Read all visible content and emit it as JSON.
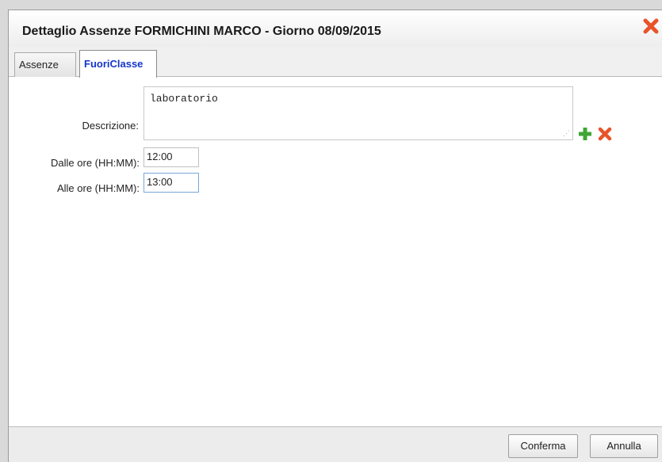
{
  "dialog": {
    "title": "Dettaglio Assenze FORMICHINI MARCO - Giorno 08/09/2015"
  },
  "tabs": [
    {
      "label": "Assenze",
      "active": false
    },
    {
      "label": "FuoriClasse",
      "active": true
    }
  ],
  "form": {
    "description_label": "Descrizione:",
    "description_value": "laboratorio",
    "from_label": "Dalle ore (HH:MM):",
    "from_value": "12:00",
    "to_label": "Alle ore (HH:MM):",
    "to_value": "13:00"
  },
  "icons": {
    "close": "close-icon",
    "add": "plus-icon",
    "delete": "x-icon"
  },
  "colors": {
    "active_tab_text": "#1536c8",
    "add_icon": "#3fa535",
    "delete_icon": "#e8542a"
  },
  "footer": {
    "confirm_label": "Conferma",
    "cancel_label": "Annulla"
  }
}
